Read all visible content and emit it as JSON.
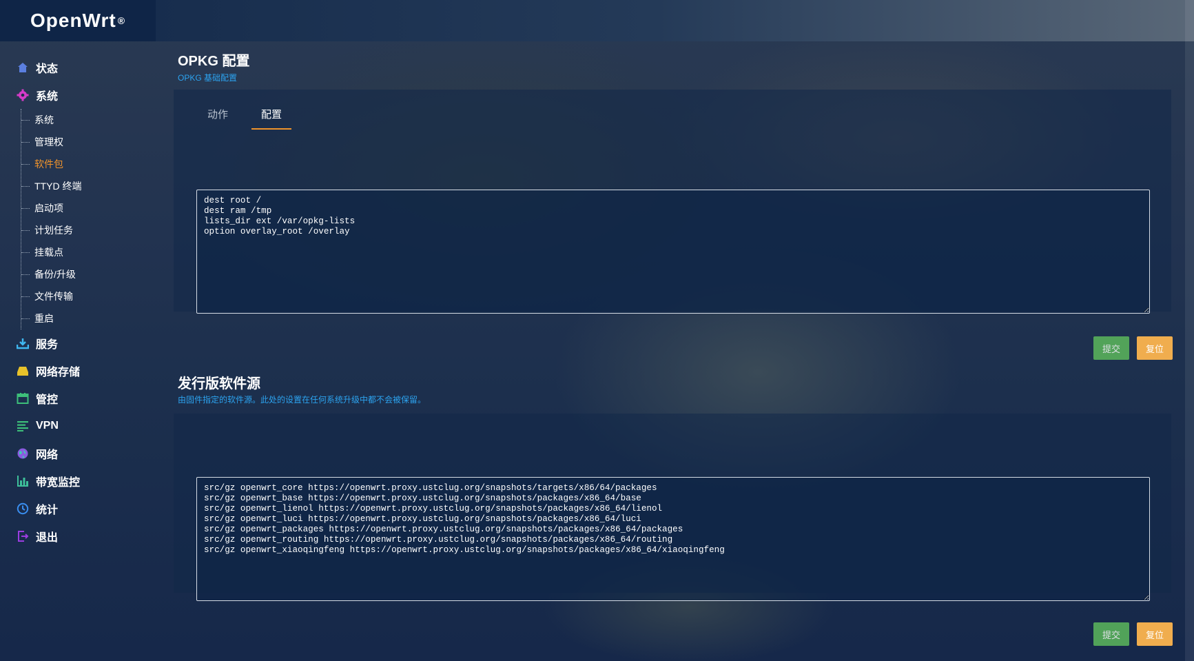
{
  "brand": {
    "name": "OpenWrt",
    "mark": "®"
  },
  "sidebar": {
    "top_items": [
      {
        "label": "状态",
        "icon": "home-icon"
      },
      {
        "label": "系统",
        "icon": "gear-icon"
      }
    ],
    "system_sub": [
      "系统",
      "管理权",
      "软件包",
      "TTYD 终端",
      "启动项",
      "计划任务",
      "挂载点",
      "备份/升级",
      "文件传输",
      "重启"
    ],
    "active_sub": "软件包",
    "bottom_items": [
      {
        "label": "服务",
        "icon": "download-tray-icon"
      },
      {
        "label": "网络存储",
        "icon": "drive-icon"
      },
      {
        "label": "管控",
        "icon": "calendar-icon"
      },
      {
        "label": "VPN",
        "icon": "lines-icon"
      },
      {
        "label": "网络",
        "icon": "globe-icon"
      },
      {
        "label": "带宽监控",
        "icon": "bar-chart-icon"
      },
      {
        "label": "统计",
        "icon": "clock-icon"
      },
      {
        "label": "退出",
        "icon": "logout-icon"
      }
    ]
  },
  "opkg": {
    "title": "OPKG 配置",
    "desc": "OPKG 基础配置",
    "tabs": [
      "动作",
      "配置"
    ],
    "active_tab": "配置",
    "config_text": "dest root /\ndest ram /tmp\nlists_dir ext /var/opkg-lists\noption overlay_root /overlay",
    "submit_label": "提交",
    "reset_label": "复位"
  },
  "feeds": {
    "title": "发行版软件源",
    "desc": "由固件指定的软件源。此处的设置在任何系统升级中都不会被保留。",
    "feeds_text": "src/gz openwrt_core https://openwrt.proxy.ustclug.org/snapshots/targets/x86/64/packages\nsrc/gz openwrt_base https://openwrt.proxy.ustclug.org/snapshots/packages/x86_64/base\nsrc/gz openwrt_lienol https://openwrt.proxy.ustclug.org/snapshots/packages/x86_64/lienol\nsrc/gz openwrt_luci https://openwrt.proxy.ustclug.org/snapshots/packages/x86_64/luci\nsrc/gz openwrt_packages https://openwrt.proxy.ustclug.org/snapshots/packages/x86_64/packages\nsrc/gz openwrt_routing https://openwrt.proxy.ustclug.org/snapshots/packages/x86_64/routing\nsrc/gz openwrt_xiaoqingfeng https://openwrt.proxy.ustclug.org/snapshots/packages/x86_64/xiaoqingfeng",
    "submit_label": "提交",
    "reset_label": "复位"
  },
  "colors": {
    "accent": "#f0932b",
    "link": "#2ca3ef",
    "submit": "#5cb85c",
    "reset": "#f0ad4e"
  }
}
